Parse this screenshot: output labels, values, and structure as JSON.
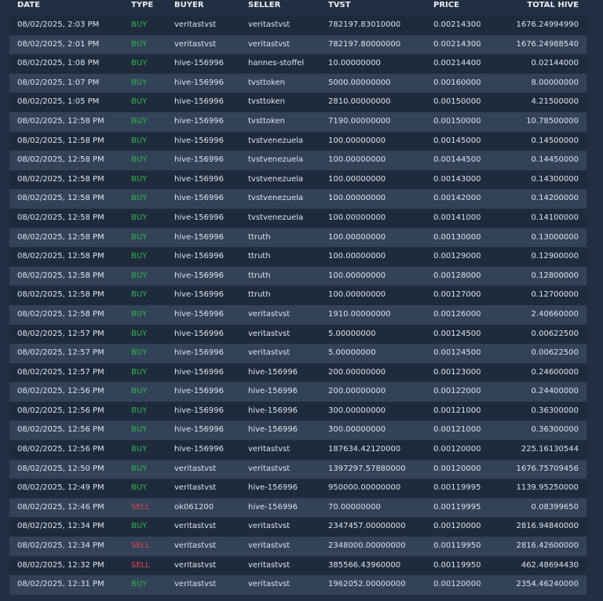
{
  "colors": {
    "background": "#232e42",
    "row_odd": "#1f2a3c",
    "row_even": "#324258",
    "buy": "#2fb84a",
    "sell": "#e04b52"
  },
  "table": {
    "headers": {
      "date": "DATE",
      "type": "TYPE",
      "buyer": "BUYER",
      "seller": "SELLER",
      "tvst": "TVST",
      "price": "PRICE",
      "total": "TOTAL HIVE"
    },
    "rows": [
      {
        "date": "08/02/2025, 2:03 PM",
        "type": "BUY",
        "buyer": "veritastvst",
        "seller": "veritastvst",
        "tvst": "782197.83010000",
        "price": "0.00214300",
        "total": "1676.24994990"
      },
      {
        "date": "08/02/2025, 2:01 PM",
        "type": "BUY",
        "buyer": "veritastvst",
        "seller": "veritastvst",
        "tvst": "782197.80000000",
        "price": "0.00214300",
        "total": "1676.24988540"
      },
      {
        "date": "08/02/2025, 1:08 PM",
        "type": "BUY",
        "buyer": "hive-156996",
        "seller": "hannes-stoffel",
        "tvst": "10.00000000",
        "price": "0.00214400",
        "total": "0.02144000"
      },
      {
        "date": "08/02/2025, 1:07 PM",
        "type": "BUY",
        "buyer": "hive-156996",
        "seller": "tvsttoken",
        "tvst": "5000.00000000",
        "price": "0.00160000",
        "total": "8.00000000"
      },
      {
        "date": "08/02/2025, 1:05 PM",
        "type": "BUY",
        "buyer": "hive-156996",
        "seller": "tvsttoken",
        "tvst": "2810.00000000",
        "price": "0.00150000",
        "total": "4.21500000"
      },
      {
        "date": "08/02/2025, 12:58 PM",
        "type": "BUY",
        "buyer": "hive-156996",
        "seller": "tvsttoken",
        "tvst": "7190.00000000",
        "price": "0.00150000",
        "total": "10.78500000"
      },
      {
        "date": "08/02/2025, 12:58 PM",
        "type": "BUY",
        "buyer": "hive-156996",
        "seller": "tvstvenezuela",
        "tvst": "100.00000000",
        "price": "0.00145000",
        "total": "0.14500000"
      },
      {
        "date": "08/02/2025, 12:58 PM",
        "type": "BUY",
        "buyer": "hive-156996",
        "seller": "tvstvenezuela",
        "tvst": "100.00000000",
        "price": "0.00144500",
        "total": "0.14450000"
      },
      {
        "date": "08/02/2025, 12:58 PM",
        "type": "BUY",
        "buyer": "hive-156996",
        "seller": "tvstvenezuela",
        "tvst": "100.00000000",
        "price": "0.00143000",
        "total": "0.14300000"
      },
      {
        "date": "08/02/2025, 12:58 PM",
        "type": "BUY",
        "buyer": "hive-156996",
        "seller": "tvstvenezuela",
        "tvst": "100.00000000",
        "price": "0.00142000",
        "total": "0.14200000"
      },
      {
        "date": "08/02/2025, 12:58 PM",
        "type": "BUY",
        "buyer": "hive-156996",
        "seller": "tvstvenezuela",
        "tvst": "100.00000000",
        "price": "0.00141000",
        "total": "0.14100000"
      },
      {
        "date": "08/02/2025, 12:58 PM",
        "type": "BUY",
        "buyer": "hive-156996",
        "seller": "ttruth",
        "tvst": "100.00000000",
        "price": "0.00130000",
        "total": "0.13000000"
      },
      {
        "date": "08/02/2025, 12:58 PM",
        "type": "BUY",
        "buyer": "hive-156996",
        "seller": "ttruth",
        "tvst": "100.00000000",
        "price": "0.00129000",
        "total": "0.12900000"
      },
      {
        "date": "08/02/2025, 12:58 PM",
        "type": "BUY",
        "buyer": "hive-156996",
        "seller": "ttruth",
        "tvst": "100.00000000",
        "price": "0.00128000",
        "total": "0.12800000"
      },
      {
        "date": "08/02/2025, 12:58 PM",
        "type": "BUY",
        "buyer": "hive-156996",
        "seller": "ttruth",
        "tvst": "100.00000000",
        "price": "0.00127000",
        "total": "0.12700000"
      },
      {
        "date": "08/02/2025, 12:58 PM",
        "type": "BUY",
        "buyer": "hive-156996",
        "seller": "veritastvst",
        "tvst": "1910.00000000",
        "price": "0.00126000",
        "total": "2.40660000"
      },
      {
        "date": "08/02/2025, 12:57 PM",
        "type": "BUY",
        "buyer": "hive-156996",
        "seller": "veritastvst",
        "tvst": "5.00000000",
        "price": "0.00124500",
        "total": "0.00622500"
      },
      {
        "date": "08/02/2025, 12:57 PM",
        "type": "BUY",
        "buyer": "hive-156996",
        "seller": "veritastvst",
        "tvst": "5.00000000",
        "price": "0.00124500",
        "total": "0.00622500"
      },
      {
        "date": "08/02/2025, 12:57 PM",
        "type": "BUY",
        "buyer": "hive-156996",
        "seller": "hive-156996",
        "tvst": "200.00000000",
        "price": "0.00123000",
        "total": "0.24600000"
      },
      {
        "date": "08/02/2025, 12:56 PM",
        "type": "BUY",
        "buyer": "hive-156996",
        "seller": "hive-156996",
        "tvst": "200.00000000",
        "price": "0.00122000",
        "total": "0.24400000"
      },
      {
        "date": "08/02/2025, 12:56 PM",
        "type": "BUY",
        "buyer": "hive-156996",
        "seller": "hive-156996",
        "tvst": "300.00000000",
        "price": "0.00121000",
        "total": "0.36300000"
      },
      {
        "date": "08/02/2025, 12:56 PM",
        "type": "BUY",
        "buyer": "hive-156996",
        "seller": "hive-156996",
        "tvst": "300.00000000",
        "price": "0.00121000",
        "total": "0.36300000"
      },
      {
        "date": "08/02/2025, 12:56 PM",
        "type": "BUY",
        "buyer": "hive-156996",
        "seller": "veritastvst",
        "tvst": "187634.42120000",
        "price": "0.00120000",
        "total": "225.16130544"
      },
      {
        "date": "08/02/2025, 12:50 PM",
        "type": "BUY",
        "buyer": "veritastvst",
        "seller": "veritastvst",
        "tvst": "1397297.57880000",
        "price": "0.00120000",
        "total": "1676.75709456"
      },
      {
        "date": "08/02/2025, 12:49 PM",
        "type": "BUY",
        "buyer": "veritastvst",
        "seller": "hive-156996",
        "tvst": "950000.00000000",
        "price": "0.00119995",
        "total": "1139.95250000"
      },
      {
        "date": "08/02/2025, 12:46 PM",
        "type": "SELL",
        "buyer": "ok061200",
        "seller": "hive-156996",
        "tvst": "70.00000000",
        "price": "0.00119995",
        "total": "0.08399650"
      },
      {
        "date": "08/02/2025, 12:34 PM",
        "type": "BUY",
        "buyer": "veritastvst",
        "seller": "veritastvst",
        "tvst": "2347457.00000000",
        "price": "0.00120000",
        "total": "2816.94840000"
      },
      {
        "date": "08/02/2025, 12:34 PM",
        "type": "SELL",
        "buyer": "veritastvst",
        "seller": "veritastvst",
        "tvst": "2348000.00000000",
        "price": "0.00119950",
        "total": "2816.42600000"
      },
      {
        "date": "08/02/2025, 12:32 PM",
        "type": "SELL",
        "buyer": "veritastvst",
        "seller": "veritastvst",
        "tvst": "385566.43960000",
        "price": "0.00119950",
        "total": "462.48694430"
      },
      {
        "date": "08/02/2025, 12:31 PM",
        "type": "BUY",
        "buyer": "veritastvst",
        "seller": "veritastvst",
        "tvst": "1962052.00000000",
        "price": "0.00120000",
        "total": "2354.46240000"
      }
    ]
  }
}
